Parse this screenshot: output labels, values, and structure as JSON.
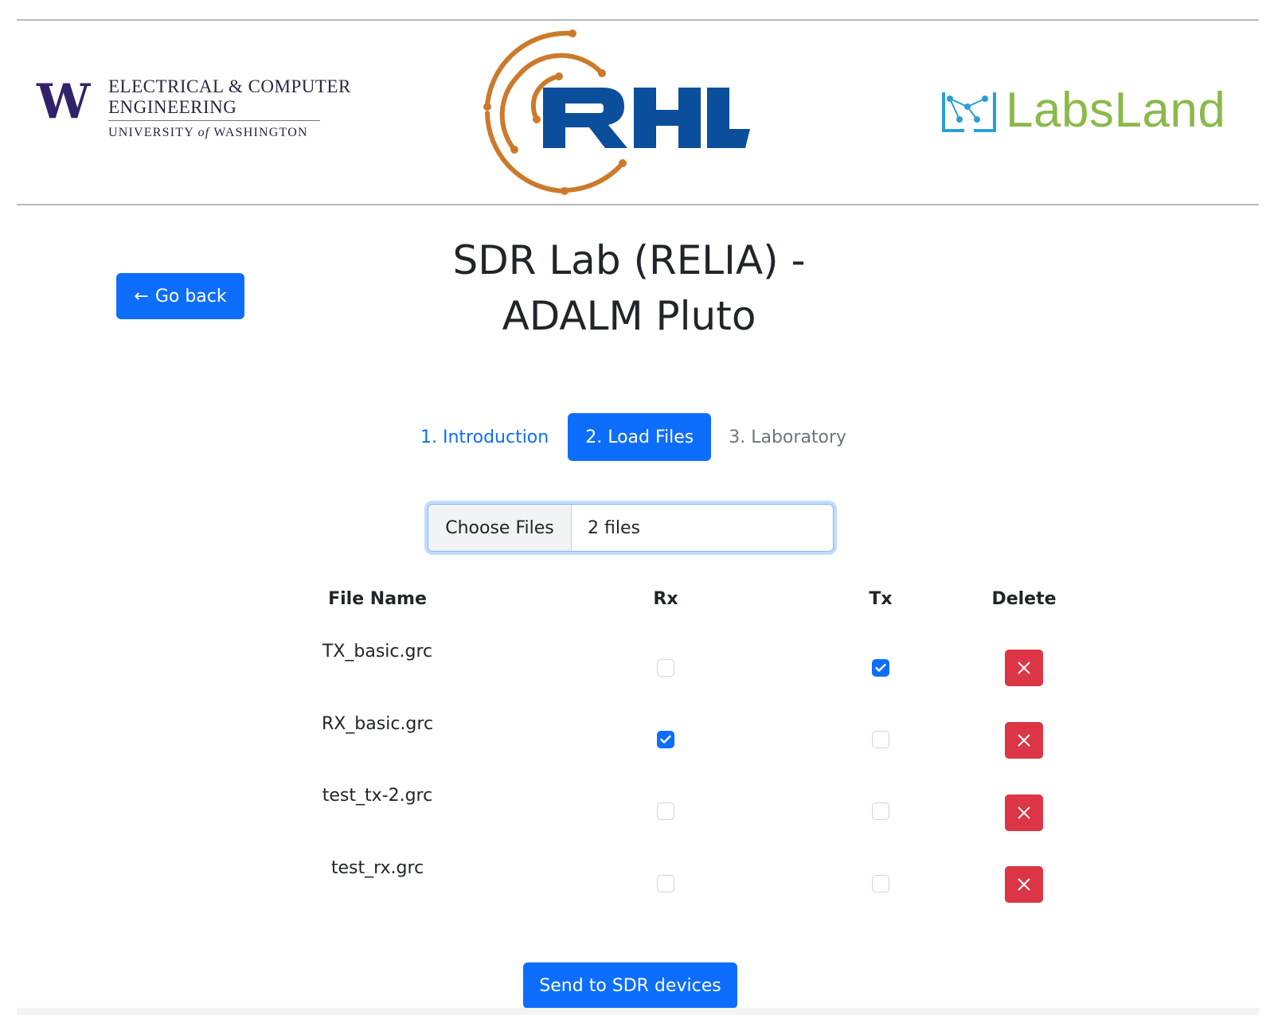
{
  "header": {
    "uw_logo": {
      "mark": "W",
      "line1": "ELECTRICAL & COMPUTER",
      "line2": "ENGINEERING",
      "line3_a": "UNIVERSITY ",
      "line3_of": "of",
      "line3_b": " WASHINGTON",
      "brand_color": "#32226b"
    },
    "rhl_logo": {
      "text": "RHL",
      "brand_color": "#0b4f9c",
      "arc_color": "#cc7a2a"
    },
    "labsland_logo": {
      "text": "LabsLand",
      "brand_color": "#8bb94a",
      "icon_color": "#2a9fd6"
    }
  },
  "page": {
    "title_line1": "SDR Lab (RELIA) -",
    "title_line2": "ADALM Pluto",
    "go_back_label": "Go back",
    "go_back_icon": "arrow-left-icon"
  },
  "tabs": [
    {
      "label": "1. Introduction",
      "state": "link"
    },
    {
      "label": "2. Load Files",
      "state": "active"
    },
    {
      "label": "3. Laboratory",
      "state": "disabled"
    }
  ],
  "file_input": {
    "button_label": "Choose Files",
    "value_text": "2 files"
  },
  "table": {
    "headers": {
      "name": "File Name",
      "rx": "Rx",
      "tx": "Tx",
      "delete": "Delete"
    },
    "rows": [
      {
        "name": "TX_basic.grc",
        "rx": false,
        "tx": true
      },
      {
        "name": "RX_basic.grc",
        "rx": true,
        "tx": false
      },
      {
        "name": "test_tx-2.grc",
        "rx": false,
        "tx": false
      },
      {
        "name": "test_rx.grc",
        "rx": false,
        "tx": false
      }
    ],
    "delete_icon": "x-icon"
  },
  "actions": {
    "send_label": "Send to SDR devices"
  },
  "colors": {
    "primary": "#0d6efd",
    "danger": "#dc3545",
    "muted": "#6c757d"
  }
}
